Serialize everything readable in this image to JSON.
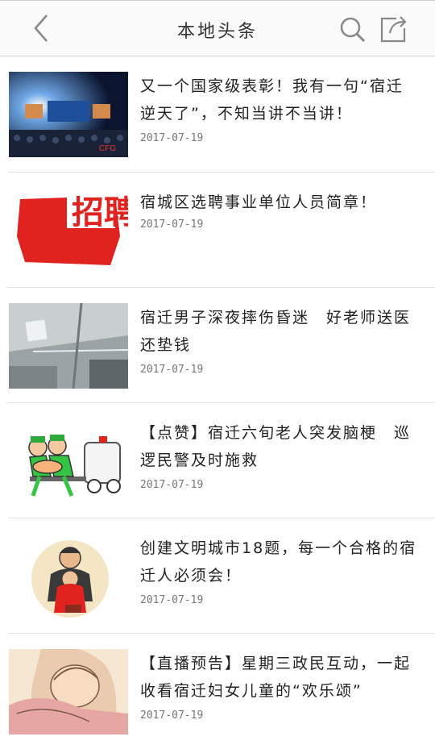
{
  "header": {
    "title": "本地头条",
    "back_icon": "chevron-left-icon",
    "search_icon": "search-icon",
    "share_icon": "share-icon"
  },
  "articles": [
    {
      "title": "又一个国家级表彰！我有一句“宿迁逆天了”，不知当讲不当讲！",
      "date": "2017-07-19",
      "thumb_logo": "CFG"
    },
    {
      "title": "宿城区选聘事业单位人员简章！",
      "date": "2017-07-19",
      "thumb_text": "招聘"
    },
    {
      "title": "宿迁男子深夜摔伤昏迷　好老师送医还垫钱",
      "date": "2017-07-19"
    },
    {
      "title": "【点赞】宿迁六旬老人突发脑梗　巡逻民警及时施救",
      "date": "2017-07-19"
    },
    {
      "title": "创建文明城市18题，每一个合格的宿迁人必须会！",
      "date": "2017-07-19"
    },
    {
      "title": "【直播预告】星期三政民互动，一起收看宿迁妇女儿童的“欢乐颂”",
      "date": "2017-07-19"
    }
  ]
}
